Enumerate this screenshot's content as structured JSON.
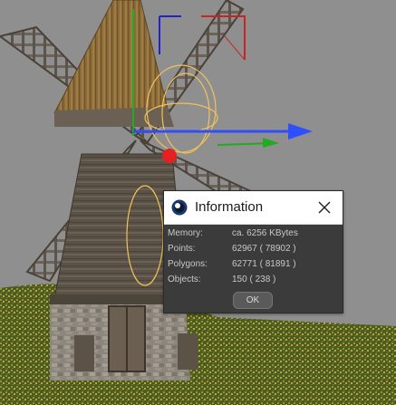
{
  "dialog": {
    "title": "Information",
    "rows": [
      {
        "label": "Memory:",
        "value": "ca. 6256 KBytes"
      },
      {
        "label": "Points:",
        "value": "62967 ( 78902 )"
      },
      {
        "label": "Polygons:",
        "value": "62771 ( 81891 )"
      },
      {
        "label": "Objects:",
        "value": "150 ( 238 )"
      }
    ],
    "ok_label": "OK"
  },
  "colors": {
    "viewport_background": "#8f8f8f",
    "axis_x": "#2f4fff",
    "axis_y": "#22aa22",
    "axis_z": "#2222cc",
    "gizmo_ring": "#f2c25a",
    "pivot": "#e62020",
    "dialog_background": "#3b3b3b"
  },
  "icons": {
    "app": "cinema4d-logo-icon",
    "close": "close-icon"
  }
}
